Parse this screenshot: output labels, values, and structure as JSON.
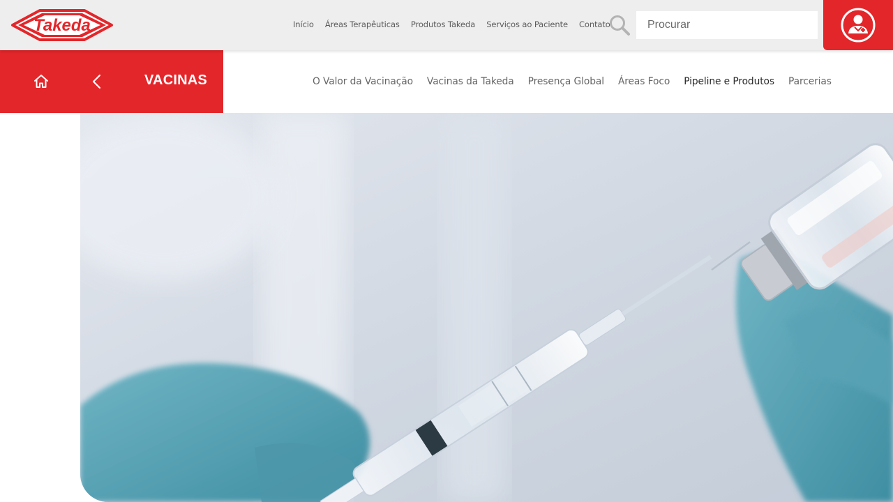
{
  "brand": {
    "logo_text": "Takeda",
    "accent_color": "#e3262a"
  },
  "top_nav": {
    "items": [
      {
        "label": "Início"
      },
      {
        "label": "Áreas Terapêuticas"
      },
      {
        "label": "Produtos Takeda"
      },
      {
        "label": "Serviços ao Paciente"
      },
      {
        "label": "Contato"
      }
    ]
  },
  "search": {
    "placeholder": "Procurar",
    "value": "",
    "icon": "search-icon"
  },
  "user_button": {
    "icon": "doctor-user-icon"
  },
  "section": {
    "title": "VACINAS",
    "home_icon": "home-icon",
    "back_icon": "chevron-left-icon"
  },
  "sub_nav": {
    "items": [
      {
        "label": "O Valor da Vacinação"
      },
      {
        "label": "Vacinas da Takeda"
      },
      {
        "label": "Presença Global"
      },
      {
        "label": "Áreas Foco"
      },
      {
        "label": "Pipeline e Produtos",
        "active": true
      },
      {
        "label": "Parcerias"
      }
    ]
  },
  "hero": {
    "image_subject": "gloved hands filling a syringe from a vaccine vial"
  }
}
